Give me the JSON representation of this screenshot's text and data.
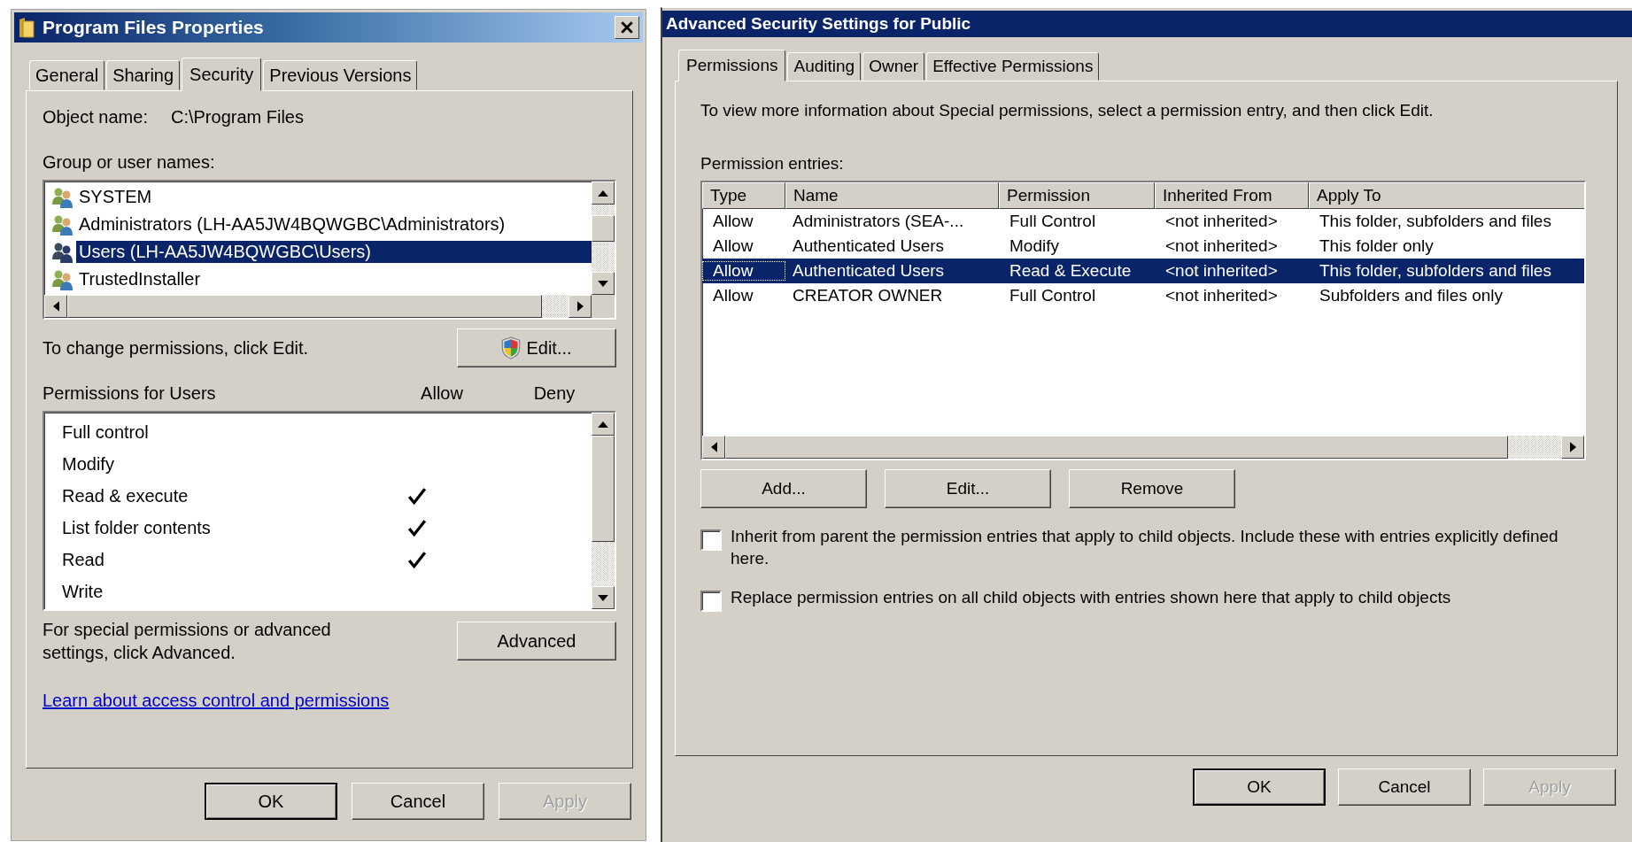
{
  "properties_dialog": {
    "title": "Program Files Properties",
    "tabs": [
      {
        "label": "General",
        "selected": false
      },
      {
        "label": "Sharing",
        "selected": false
      },
      {
        "label": "Security",
        "selected": true
      },
      {
        "label": "Previous Versions",
        "selected": false
      }
    ],
    "object_name": {
      "label": "Object name:",
      "value": "C:\\Program Files"
    },
    "groups_label": "Group or user names:",
    "groups": [
      {
        "name": "SYSTEM",
        "selected": false
      },
      {
        "name": "Administrators (LH-AA5JW4BQWGBC\\Administrators)",
        "selected": false
      },
      {
        "name": "Users (LH-AA5JW4BQWGBC\\Users)",
        "selected": true
      },
      {
        "name": "TrustedInstaller",
        "selected": false
      }
    ],
    "change_hint": "To change permissions, click Edit.",
    "edit_button": "Edit...",
    "permissions_label": "Permissions for Users",
    "allow_label": "Allow",
    "deny_label": "Deny",
    "permissions": [
      {
        "name": "Full control",
        "allow": false,
        "deny": false
      },
      {
        "name": "Modify",
        "allow": false,
        "deny": false
      },
      {
        "name": "Read & execute",
        "allow": true,
        "deny": false
      },
      {
        "name": "List folder contents",
        "allow": true,
        "deny": false
      },
      {
        "name": "Read",
        "allow": true,
        "deny": false
      },
      {
        "name": "Write",
        "allow": false,
        "deny": false
      }
    ],
    "advanced_hint": "For special permissions or advanced settings, click Advanced.",
    "advanced_button": "Advanced",
    "learn_link": "Learn about access control and permissions",
    "buttons": [
      {
        "label": "OK",
        "default": true,
        "disabled": false
      },
      {
        "label": "Cancel",
        "default": false,
        "disabled": false
      },
      {
        "label": "Apply",
        "default": false,
        "disabled": true
      }
    ]
  },
  "advanced_dialog": {
    "title": "Advanced Security Settings for Public",
    "tabs": [
      {
        "label": "Permissions",
        "selected": true
      },
      {
        "label": "Auditing",
        "selected": false
      },
      {
        "label": "Owner",
        "selected": false
      },
      {
        "label": "Effective Permissions",
        "selected": false
      }
    ],
    "info": "To view more information about Special permissions, select a permission entry, and then click Edit.",
    "entries_label": "Permission entries:",
    "table": {
      "columns": [
        "Type",
        "Name",
        "Permission",
        "Inherited From",
        "Apply To"
      ],
      "rows": [
        {
          "cells": [
            "Allow",
            "Administrators (SEA-...",
            "Full Control",
            "<not inherited>",
            "This folder, subfolders and files"
          ],
          "selected": false
        },
        {
          "cells": [
            "Allow",
            "Authenticated Users",
            "Modify",
            "<not inherited>",
            "This folder only"
          ],
          "selected": false
        },
        {
          "cells": [
            "Allow",
            "Authenticated Users",
            "Read & Execute",
            "<not inherited>",
            "This folder, subfolders and files"
          ],
          "selected": true
        },
        {
          "cells": [
            "Allow",
            "CREATOR OWNER",
            "Full Control",
            "<not inherited>",
            "Subfolders and files only"
          ],
          "selected": false
        }
      ]
    },
    "entry_buttons": [
      "Add...",
      "Edit...",
      "Remove"
    ],
    "options": [
      {
        "label": "Inherit from parent the permission entries that apply to child objects. Include these with entries explicitly defined here.",
        "checked": false
      },
      {
        "label": "Replace permission entries on all child objects with entries shown here that apply to child objects",
        "checked": false
      }
    ],
    "buttons": [
      {
        "label": "OK",
        "default": true,
        "disabled": false
      },
      {
        "label": "Cancel",
        "default": false,
        "disabled": false
      },
      {
        "label": "Apply",
        "default": false,
        "disabled": true
      }
    ]
  }
}
